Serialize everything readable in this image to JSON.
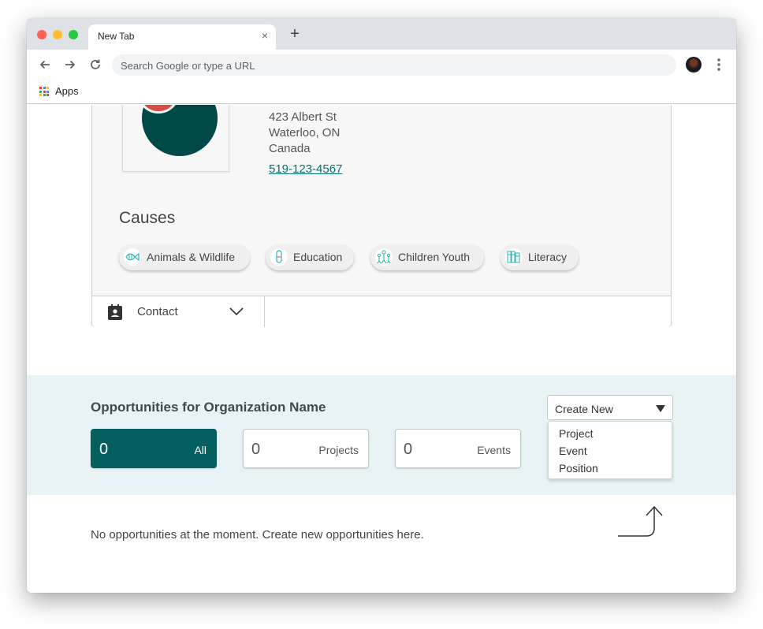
{
  "browser": {
    "tab_title": "New Tab",
    "tab_close": "×",
    "new_tab": "+",
    "omnibox_placeholder": "Search Google or type a URL",
    "bookmark_apps_label": "Apps",
    "icons": {
      "back": "back-arrow-icon",
      "forward": "forward-arrow-icon",
      "reload": "reload-icon",
      "menu": "kebab-menu-icon"
    }
  },
  "organization": {
    "address_lines": [
      "423 Albert St",
      "Waterloo, ON",
      "Canada"
    ],
    "phone": "519-123-4567",
    "logo_colors": {
      "primary": "#014848",
      "accent": "#d94b44"
    }
  },
  "causes": {
    "title": "Causes",
    "items": [
      {
        "label": "Animals & Wildlife",
        "icon": "fish-icon"
      },
      {
        "label": "Education",
        "icon": "test-tube-icon"
      },
      {
        "label": "Children Youth",
        "icon": "children-icon"
      },
      {
        "label": "Literacy",
        "icon": "books-icon"
      }
    ]
  },
  "contact": {
    "label": "Contact"
  },
  "opportunities": {
    "title": "Opportunities for Organization Name",
    "stats": [
      {
        "count": "0",
        "label": "All",
        "active": true
      },
      {
        "count": "0",
        "label": "Projects",
        "active": false
      },
      {
        "count": "0",
        "label": "Events",
        "active": false
      }
    ],
    "create_new": {
      "label": "Create New",
      "options": [
        "Project",
        "Event",
        "Position"
      ]
    },
    "empty_message": "No opportunities at the moment. Create new opportunities here."
  },
  "colors": {
    "accent": "#065f5f",
    "section_bg": "#e7f3f4",
    "link": "#087070",
    "chip_icon": "#2fb3b3"
  }
}
